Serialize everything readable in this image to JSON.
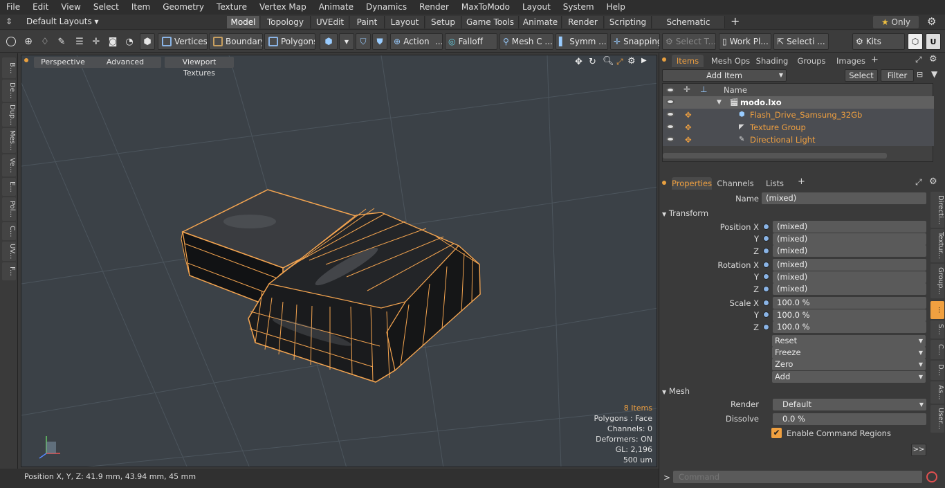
{
  "menu": [
    "File",
    "Edit",
    "View",
    "Select",
    "Item",
    "Geometry",
    "Texture",
    "Vertex Map",
    "Animate",
    "Dynamics",
    "Render",
    "MaxToModo",
    "Layout",
    "System",
    "Help"
  ],
  "layoutbar": {
    "layout_selector": "Default Layouts",
    "tabs": [
      "Model",
      "Topology",
      "UVEdit",
      "Paint",
      "Layout",
      "Setup",
      "Game Tools",
      "Animate",
      "Render",
      "Scripting",
      "Schematic Fusion"
    ],
    "add_tab": "+",
    "only_label": "Only",
    "star": "★"
  },
  "toolbar": {
    "vertices": "Vertices",
    "boundary": "Boundary",
    "polygons": "Polygons",
    "action": "Action",
    "falloff": "Falloff",
    "mesh_c": "Mesh C ...",
    "symm": "Symm ...",
    "snapping": "Snapping",
    "select_t": "Select T...",
    "work_pl": "Work Pl...",
    "selecti": "Selecti ...",
    "kits": "Kits"
  },
  "left_strip": [
    "B...",
    "De...",
    "Dup...",
    "Mes...",
    "Ve...",
    "E...",
    "Pol...",
    "C...",
    "UV...",
    "F..."
  ],
  "viewport": {
    "perspective": "Perspective",
    "advanced": "Advanced",
    "viewport_textures": "Viewport Textures",
    "stats": {
      "items": "8 Items",
      "polygons": "Polygons : Face",
      "channels": "Channels: 0",
      "deformers": "Deformers: ON",
      "gl": "GL: 2,196",
      "scale": "500 um"
    }
  },
  "statusbar": {
    "position": "Position X, Y, Z:  41.9 mm, 43.94 mm, 45 mm"
  },
  "items_panel": {
    "tabs": [
      "Items",
      "Mesh Ops",
      "Shading",
      "Groups",
      "Images"
    ],
    "add_item": "Add Item",
    "select": "Select",
    "filter": "Filter",
    "name_header": "Name",
    "rows": [
      {
        "name": "modo.lxo",
        "level": 0
      },
      {
        "name": "Flash_Drive_Samsung_32Gb",
        "level": 1
      },
      {
        "name": "Texture Group",
        "level": 1
      },
      {
        "name": "Directional Light",
        "level": 1
      }
    ]
  },
  "properties_panel": {
    "tabs": [
      "Properties",
      "Channels",
      "Lists"
    ],
    "name_label": "Name",
    "name_value": "(mixed)",
    "transform_section": "Transform",
    "position": [
      {
        "label": "Position X",
        "value": "(mixed)"
      },
      {
        "label": "Y",
        "value": "(mixed)"
      },
      {
        "label": "Z",
        "value": "(mixed)"
      }
    ],
    "rotation": [
      {
        "label": "Rotation X",
        "value": "(mixed)"
      },
      {
        "label": "Y",
        "value": "(mixed)"
      },
      {
        "label": "Z",
        "value": "(mixed)"
      }
    ],
    "scale": [
      {
        "label": "Scale X",
        "value": "100.0 %"
      },
      {
        "label": "Y",
        "value": "100.0 %"
      },
      {
        "label": "Z",
        "value": "100.0 %"
      }
    ],
    "actions": [
      "Reset",
      "Freeze",
      "Zero",
      "Add"
    ],
    "mesh_section": "Mesh",
    "render_label": "Render",
    "render_value": "Default",
    "dissolve_label": "Dissolve",
    "dissolve_value": "0.0 %",
    "enable_cmd": "Enable Command Regions",
    "more": ">>"
  },
  "right_strip": [
    "Directi...",
    "Textur...",
    "Group...",
    "...",
    "S...",
    "C...",
    "D...",
    "As...",
    "User..."
  ],
  "command": {
    "prompt": ">",
    "placeholder": "Command"
  },
  "colors": {
    "accent": "#f0a040",
    "wire": "#f5a550"
  }
}
